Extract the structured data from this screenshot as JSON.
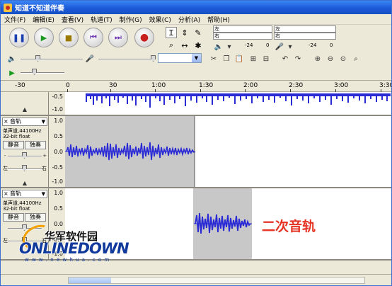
{
  "window": {
    "title": "知道不知道伴奏"
  },
  "menu": [
    "文件(F)",
    "编辑(E)",
    "查看(V)",
    "轨道(T)",
    "制作(G)",
    "效果(C)",
    "分析(A)",
    "帮助(H)"
  ],
  "meters": {
    "left_label": "左",
    "right_label": "右",
    "ticks": [
      "-24",
      "0"
    ]
  },
  "ruler": {
    "labels": [
      "-30",
      "0",
      "30",
      "1:00",
      "1:30",
      "2:00",
      "2:30",
      "3:00",
      "3:30"
    ]
  },
  "tracks": [
    {
      "name": "",
      "scale": [
        "-0.5",
        "-1.0"
      ]
    },
    {
      "name": "音轨",
      "format": "单声道,44100Hz",
      "bits": "32-bit float",
      "mute": "静音",
      "solo": "独奏",
      "pan_left": "左",
      "pan_right": "右",
      "scale": [
        "1.0",
        "0.5",
        "0.0",
        "-0.5",
        "-1.0"
      ]
    },
    {
      "name": "音轨",
      "format": "单声道,44100Hz",
      "bits": "32-bit float",
      "mute": "静音",
      "solo": "独奏",
      "pan_left": "左",
      "pan_right": "右",
      "scale": [
        "1.0",
        "0.5",
        "0.0",
        "-0.5",
        "-1.0"
      ]
    }
  ],
  "annotation": {
    "text": "二次音轨",
    "color": "#e53324"
  },
  "watermark": {
    "cn": "华军软件园",
    "en": "ONLINEDOWN",
    "url": "w w w . n e w h u a . c o m"
  },
  "colors": {
    "wave": "#2b2bd6",
    "titlebar": "#1c5ad8"
  }
}
